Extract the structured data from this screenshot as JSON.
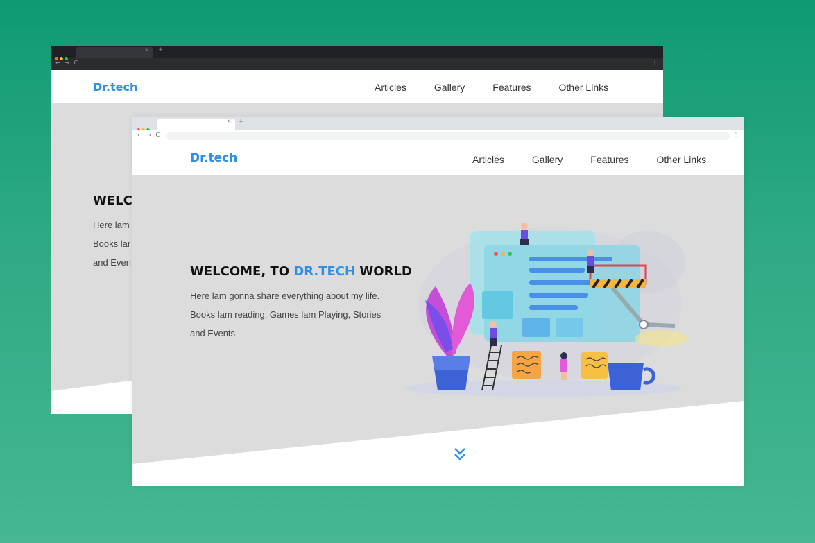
{
  "back_window": {
    "brand": "Dr.tech",
    "nav_links": [
      "Articles",
      "Gallery",
      "Features",
      "Other Links"
    ],
    "hero_title_partial": "WELC",
    "hero_lines_partial": [
      "Here lam",
      "Books lar",
      "and Even"
    ]
  },
  "front_window": {
    "tab_close": "×",
    "new_tab": "+",
    "nav_glyphs": "← → C",
    "menu_glyph": "⋮",
    "brand": "Dr.tech",
    "nav_links": [
      "Articles",
      "Gallery",
      "Features",
      "Other Links"
    ],
    "hero": {
      "title_prefix": "WELCOME, TO ",
      "title_accent": "DR.TECH",
      "title_suffix": " WORLD",
      "lines": [
        "Here lam gonna share everything about my life.",
        "Books lam reading, Games lam Playing, Stories",
        "and Events"
      ]
    }
  },
  "colors": {
    "brand": "#2f8fe6",
    "hero_bg": "#dcdcdc",
    "page_bg": "#139d76"
  }
}
